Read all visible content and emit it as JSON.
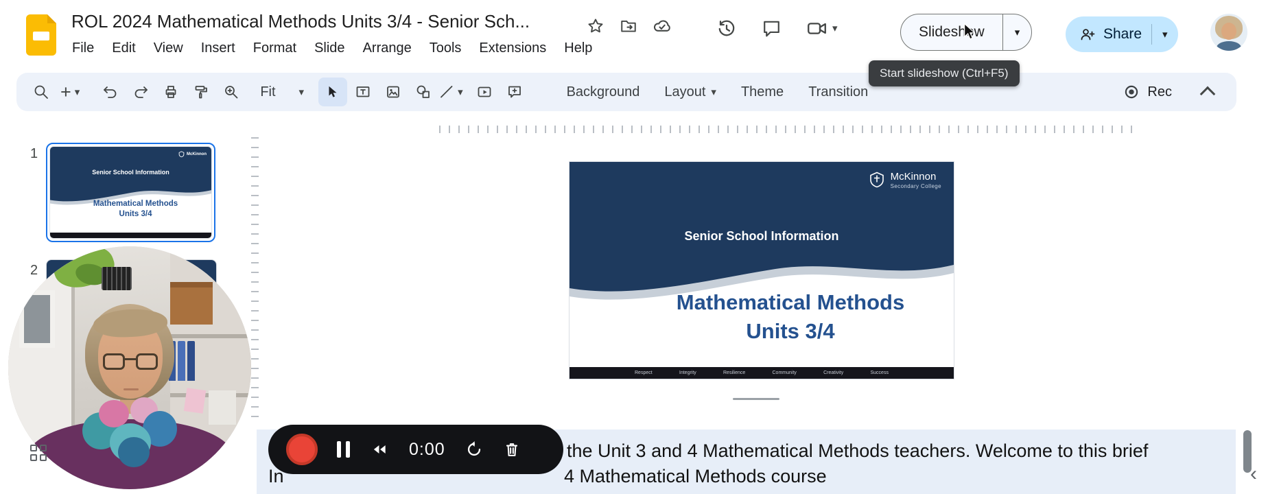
{
  "header": {
    "doc_title": "ROL 2024 Mathematical Methods Units 3/4 - Senior Sch...",
    "menu_items": [
      "File",
      "Edit",
      "View",
      "Insert",
      "Format",
      "Slide",
      "Arrange",
      "Tools",
      "Extensions",
      "Help"
    ],
    "slideshow_label": "Slideshow",
    "share_label": "Share",
    "tooltip": "Start slideshow (Ctrl+F5)"
  },
  "toolbar": {
    "zoom_value": "Fit",
    "background_label": "Background",
    "layout_label": "Layout",
    "theme_label": "Theme",
    "transition_label": "Transition",
    "rec_label": "Rec"
  },
  "filmstrip": {
    "slide1_number": "1",
    "slide2_number": "2"
  },
  "slide": {
    "logo_title": "McKinnon",
    "logo_subtitle": "Secondary College",
    "kicker": "Senior School Information",
    "title_line1": "Mathematical Methods",
    "title_line2": "Units 3/4",
    "values": [
      "Respect",
      "Integrity",
      "Resilience",
      "Community",
      "Creativity",
      "Success"
    ]
  },
  "recorder": {
    "time": "0:00"
  },
  "caption": {
    "line1": "the Unit 3 and 4 Mathematical Methods teachers. Welcome to this brief",
    "line2_fragment": "In",
    "line2": "4 Mathematical Methods course"
  },
  "icons": {
    "caret_down": "▾",
    "chevron_left": "‹",
    "plus": "+"
  },
  "colors": {
    "navy": "#1e3a5e",
    "title_blue": "#24518f",
    "selection_blue": "#1a73e8",
    "share_bg": "#c2e7ff",
    "toolbar_bg": "#edf2fa",
    "record_red": "#ea4335"
  }
}
